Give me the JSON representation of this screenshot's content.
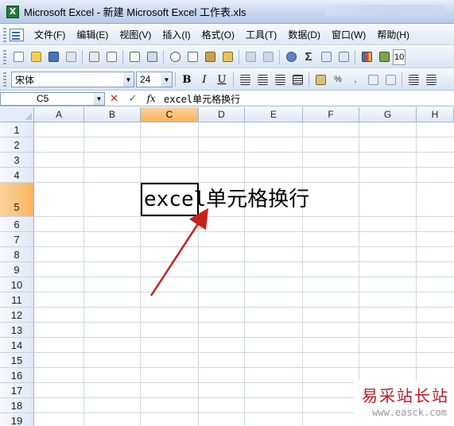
{
  "window": {
    "title": "Microsoft Excel - 新建 Microsoft Excel 工作表.xls",
    "icon_letter": "X"
  },
  "menu": {
    "items": [
      "文件(F)",
      "编辑(E)",
      "视图(V)",
      "插入(I)",
      "格式(O)",
      "工具(T)",
      "数据(D)",
      "窗口(W)",
      "帮助(H)"
    ]
  },
  "toolbar": {
    "icons": [
      "new-icon",
      "open-icon",
      "save-icon",
      "permission-icon",
      "print-icon",
      "print-preview-icon",
      "spelling-icon",
      "research-icon",
      "cut-icon",
      "copy-icon",
      "paste-icon",
      "format-painter-icon",
      "undo-icon",
      "redo-icon",
      "hyperlink-icon",
      "autosum-icon",
      "sort-ascending-icon",
      "sort-descending-icon",
      "chart-wizard-icon",
      "drawing-icon"
    ],
    "autosum_glyph": "Σ",
    "zoom_partial": "10"
  },
  "format": {
    "font_name": "宋体",
    "font_size": "24",
    "bold": "B",
    "italic": "I",
    "underline": "U",
    "percent": "%",
    "comma": ","
  },
  "formula_bar": {
    "name_box": "C5",
    "cancel": "✕",
    "enter": "✓",
    "fx": "fx",
    "content": "excel单元格换行"
  },
  "sheet": {
    "columns": [
      "A",
      "B",
      "C",
      "D",
      "E",
      "F",
      "G",
      "H"
    ],
    "rows": [
      "1",
      "2",
      "3",
      "4",
      "5",
      "6",
      "7",
      "8",
      "9",
      "10",
      "11",
      "12",
      "13",
      "14",
      "15",
      "16",
      "17",
      "18",
      "19"
    ],
    "active_cell": "C5",
    "cell_c5_text": "excel单元格换行"
  },
  "watermark": {
    "title": "易采站长站",
    "url": "www.easck.com"
  },
  "colors": {
    "selected_header": "#f7b45f",
    "arrow": "#c8201c",
    "watermark_red": "#c0171f"
  }
}
